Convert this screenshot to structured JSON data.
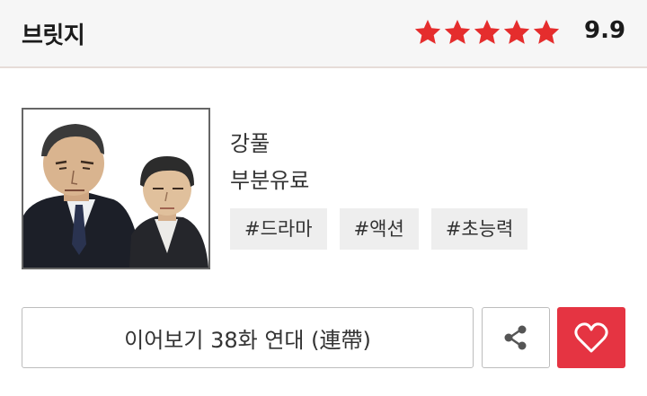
{
  "header": {
    "title": "브릿지",
    "rating_value": "9.9",
    "stars_filled": 5,
    "stars_total": 5,
    "star_color": "#e52d2d"
  },
  "work": {
    "thumbnail_icon": "cover-image",
    "author": "강풀",
    "pricing": "부분유료",
    "tags": [
      "#드라마",
      "#액션",
      "#초능력"
    ]
  },
  "actions": {
    "continue_label": "이어보기 38화 연대 (連帶)",
    "share_icon": "share-icon",
    "favorite_icon": "heart-icon",
    "favorite_color": "#e53442"
  }
}
